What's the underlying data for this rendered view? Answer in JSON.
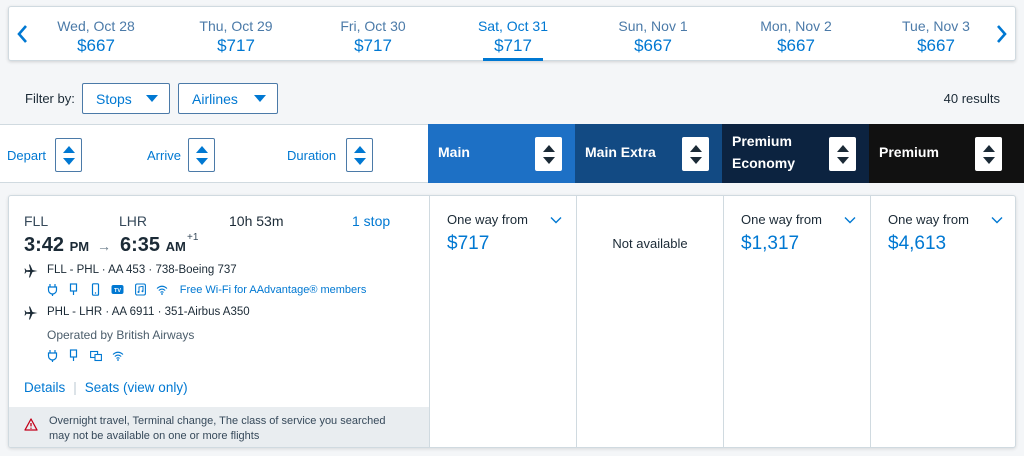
{
  "dates": [
    {
      "day": "Wed, Oct 28",
      "price": "$667"
    },
    {
      "day": "Thu, Oct 29",
      "price": "$717"
    },
    {
      "day": "Fri, Oct 30",
      "price": "$717"
    },
    {
      "day": "Sat, Oct 31",
      "price": "$717"
    },
    {
      "day": "Sun, Nov 1",
      "price": "$667"
    },
    {
      "day": "Mon, Nov 2",
      "price": "$667"
    },
    {
      "day": "Tue, Nov 3",
      "price": "$667"
    }
  ],
  "selected_date": "Sat, Oct 31",
  "filters": {
    "label": "Filter by:",
    "stops": "Stops",
    "airlines": "Airlines",
    "results": "40 results"
  },
  "sort": {
    "depart": "Depart",
    "arrive": "Arrive",
    "duration": "Duration"
  },
  "cabins": [
    {
      "name": "Main",
      "color": "#1d70c5"
    },
    {
      "name": "Main Extra",
      "color": "#124a83"
    },
    {
      "name": "Premium Economy",
      "color": "#0c2340"
    },
    {
      "name": "Premium",
      "color": "#111111"
    }
  ],
  "flight": {
    "origin": "FLL",
    "destination": "LHR",
    "duration": "10h 53m",
    "stops": "1 stop",
    "depart_time": "3:42",
    "depart_ampm": "PM",
    "arrive_time": "6:35",
    "arrive_ampm": "AM",
    "day_offset": "+1",
    "segments": [
      {
        "route": "FLL - PHL · AA 453 · 738-Boeing 737",
        "wifi": "Free Wi-Fi for AAdvantage® members"
      },
      {
        "route": "PHL - LHR · AA 6911 · 351-Airbus A350",
        "operated_by": "Operated by British Airways"
      }
    ],
    "details_link": "Details",
    "seats_link": "Seats (view only)",
    "notice": "Overnight travel, Terminal change, The class of service you searched may not be available on one or more flights"
  },
  "fares": [
    {
      "from": "One way from",
      "price": "$717"
    },
    {
      "status": "Not available"
    },
    {
      "from": "One way from",
      "price": "$1,317"
    },
    {
      "from": "One way from",
      "price": "$4,613"
    }
  ]
}
